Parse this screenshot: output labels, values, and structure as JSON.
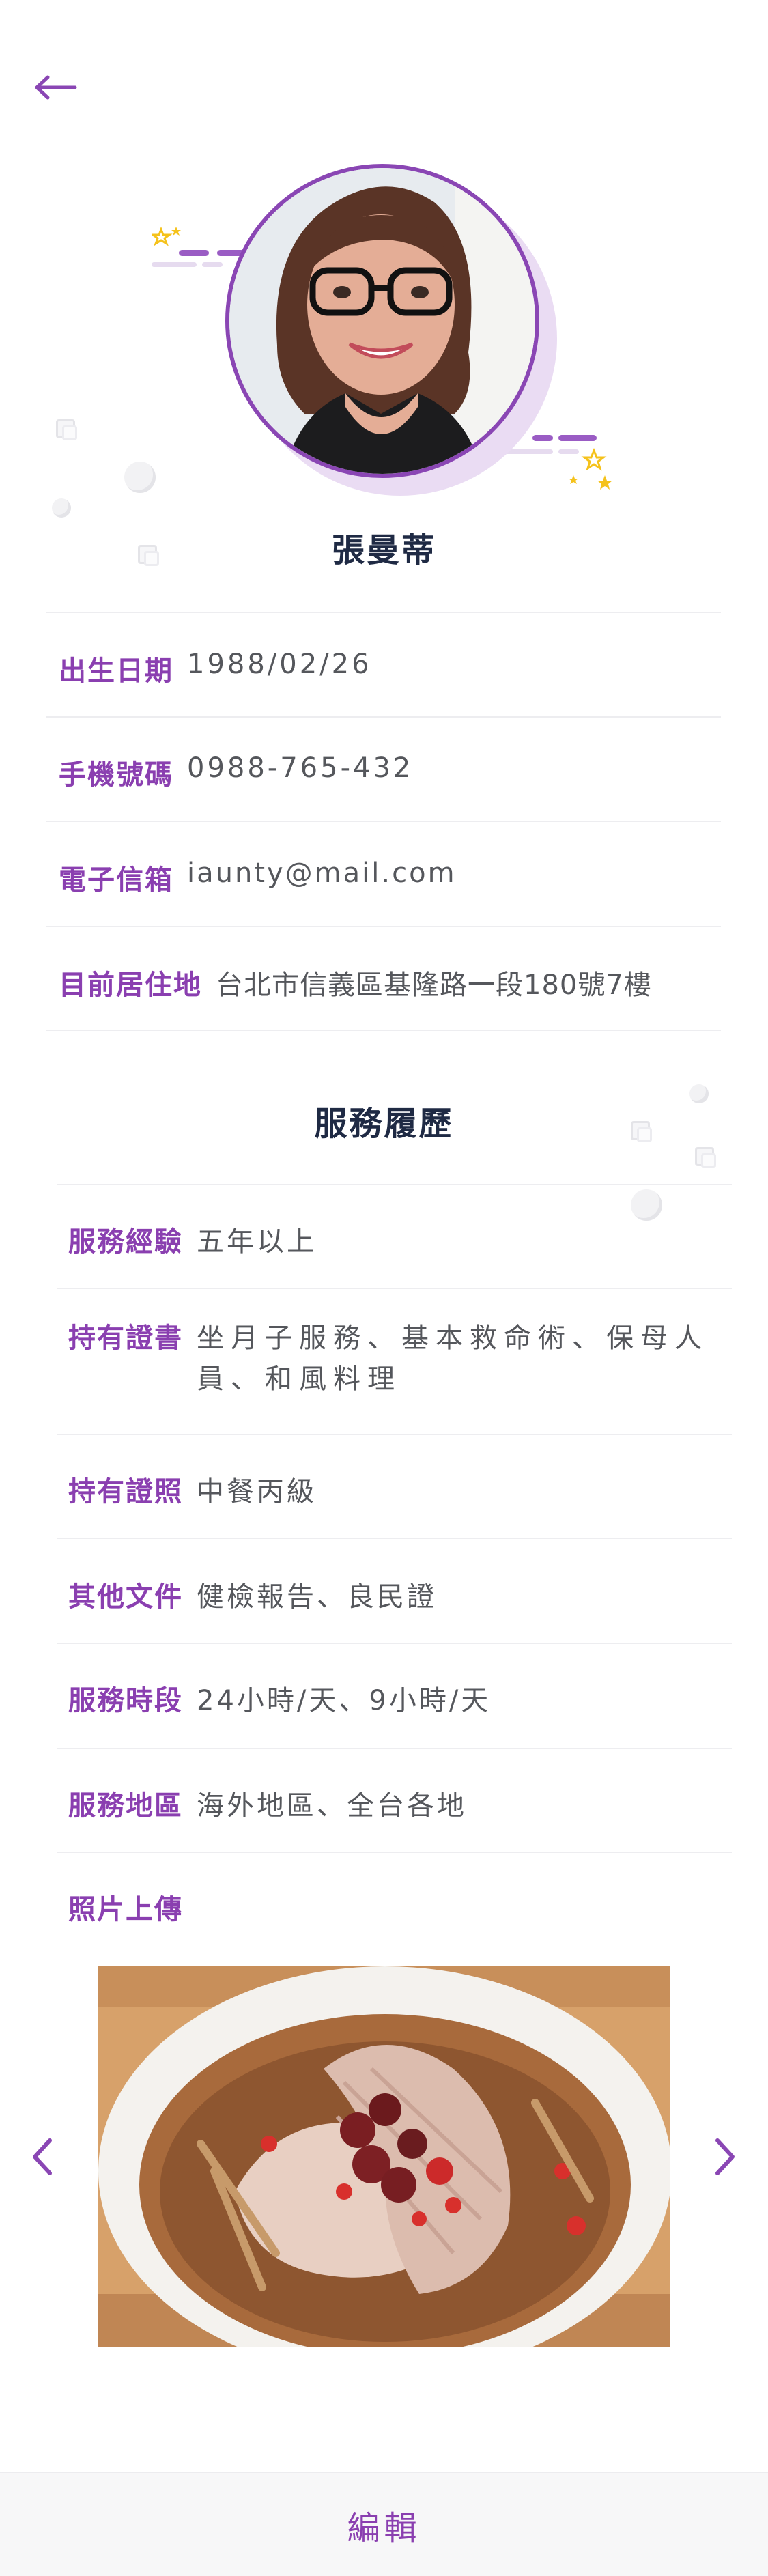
{
  "profile": {
    "name": "張曼蒂",
    "fields": [
      {
        "label": "出生日期",
        "value": "1988/02/26"
      },
      {
        "label": "手機號碼",
        "value": "0988-765-432"
      },
      {
        "label": "電子信箱",
        "value": "iaunty@mail.com"
      },
      {
        "label": "目前居住地",
        "value": "台北市信義區基隆路一段180號7樓"
      }
    ]
  },
  "service": {
    "title": "服務履歷",
    "fields": [
      {
        "label": "服務經驗",
        "value": "五年以上"
      },
      {
        "label": "持有證書",
        "value": "坐月子服務、基本救命術、保母人員、和風料理"
      },
      {
        "label": "持有證照",
        "value": "中餐丙級"
      },
      {
        "label": "其他文件",
        "value": "健檢報告、良民證"
      },
      {
        "label": "服務時段",
        "value": "24小時/天、9小時/天"
      },
      {
        "label": "服務地區",
        "value": "海外地區、全台各地"
      }
    ],
    "photo_label": "照片上傳"
  },
  "footer": {
    "edit_label": "編輯"
  },
  "icons": {
    "back": "arrow-left-icon",
    "prev": "chevron-left-icon",
    "next": "chevron-right-icon"
  },
  "colors": {
    "accent": "#8a3fb0",
    "heading": "#1f2a44",
    "text": "#55575c"
  }
}
